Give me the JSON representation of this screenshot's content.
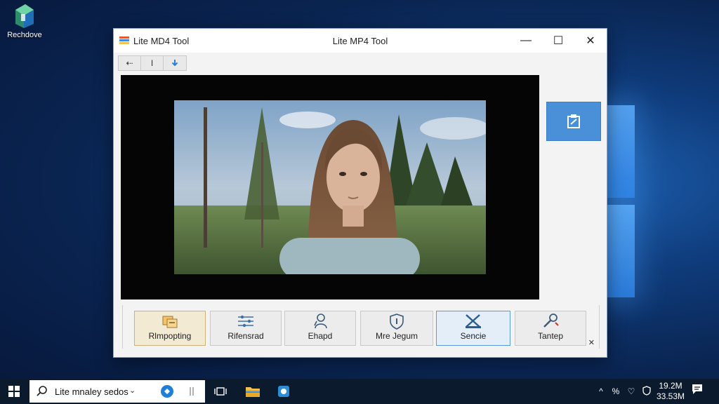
{
  "desktop": {
    "icon_label": "Rechdove"
  },
  "window": {
    "title_left": "Lite MD4 Tool",
    "title_center": "Lite MP4 Tool",
    "controls": {
      "minimize": "—",
      "maximize": "☐",
      "close": "✕"
    }
  },
  "toolbar": {
    "buttons": [
      {
        "label": "⇠",
        "icon": "back-arrow-icon"
      },
      {
        "label": "I",
        "icon": "cursor-icon"
      },
      {
        "label": "↓",
        "icon": "download-arrow-icon"
      }
    ]
  },
  "side_button": {
    "icon": "clipboard-icon"
  },
  "actions": [
    {
      "label": "Rlmpopting",
      "icon": "folder-stack-icon"
    },
    {
      "label": "Rifensrad",
      "icon": "sliders-icon"
    },
    {
      "label": "Ehapd",
      "icon": "person-icon"
    },
    {
      "label": "Mre Jegum",
      "icon": "shield-icon"
    },
    {
      "label": "Sencie",
      "icon": "scissors-icon"
    },
    {
      "label": "Tantep",
      "icon": "tool-icon"
    }
  ],
  "corner_close": "✕",
  "taskbar": {
    "search_text": "Lite mnaley sedos",
    "search_chevron": "⌄",
    "clock_time": "19.2M",
    "clock_date": "33.53M",
    "tray_symbols": [
      "^",
      "%",
      "♡"
    ]
  },
  "colors": {
    "accent": "#4a90d9",
    "taskbar_bg": "#0c1a2e",
    "selected_action": "#e3eef9"
  }
}
